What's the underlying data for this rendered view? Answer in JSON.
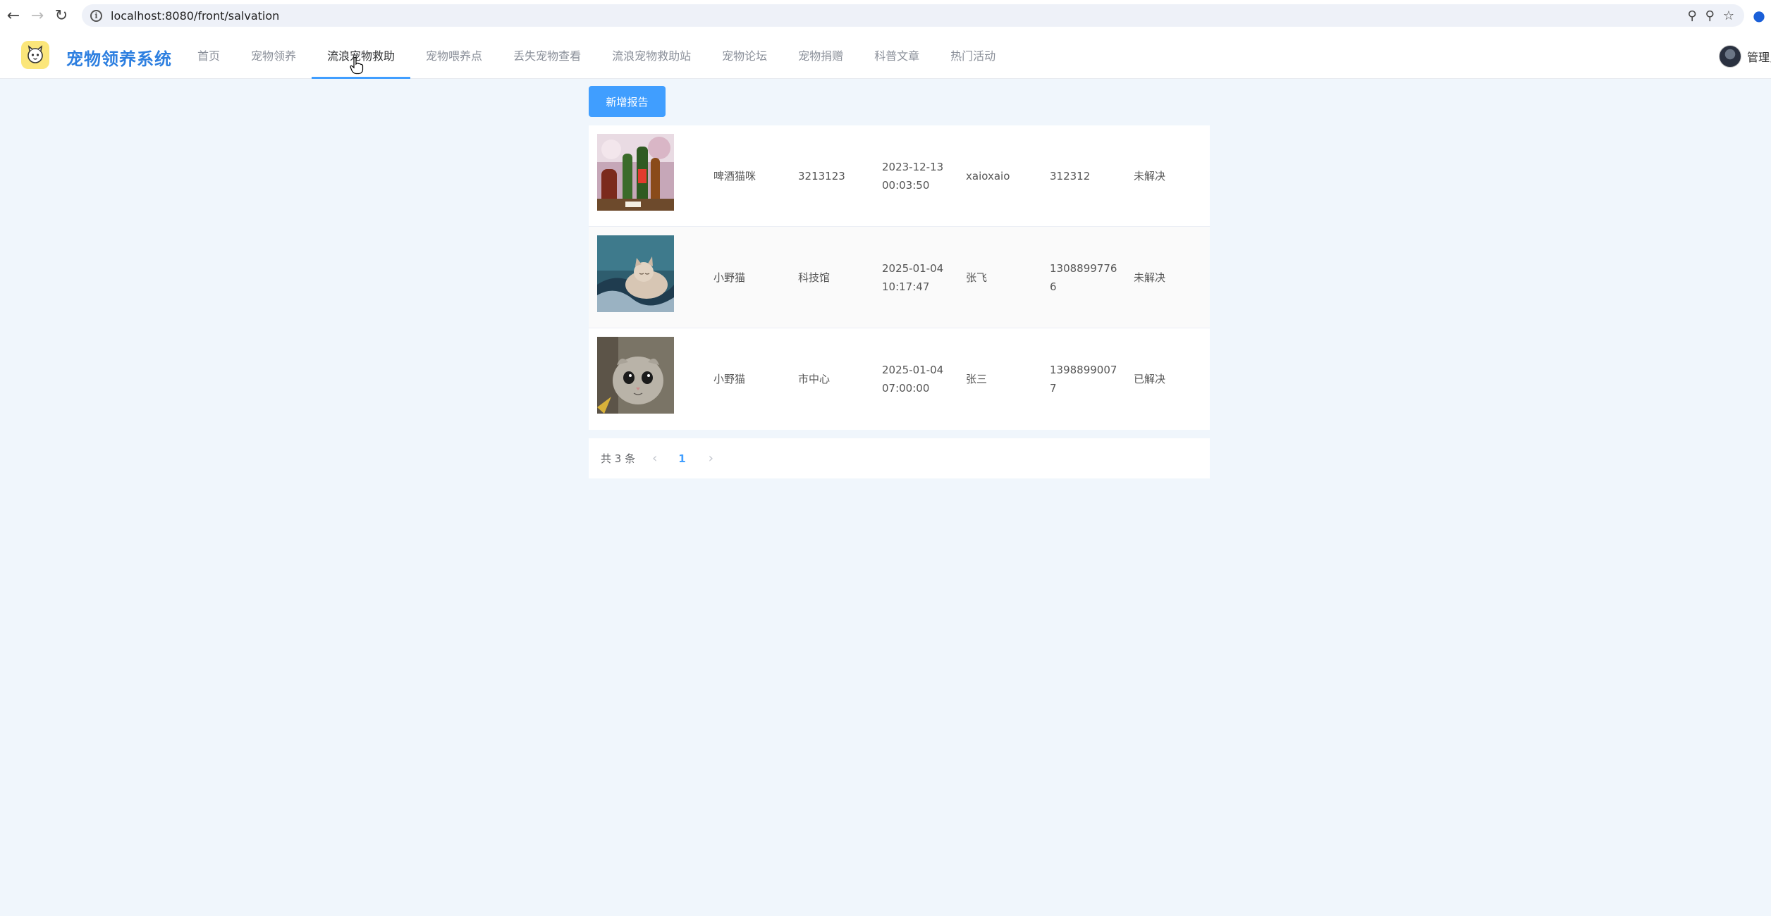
{
  "browser": {
    "url": "localhost:8080/front/salvation",
    "back_icon": "arrow-left-icon",
    "forward_icon": "arrow-right-icon",
    "reload_icon": "reload-icon"
  },
  "header": {
    "brand": "宠物领养系统",
    "nav": [
      {
        "label": "首页"
      },
      {
        "label": "宠物领养"
      },
      {
        "label": "流浪宠物救助"
      },
      {
        "label": "宠物喂养点"
      },
      {
        "label": "丢失宠物查看"
      },
      {
        "label": "流浪宠物救助站"
      },
      {
        "label": "宠物论坛"
      },
      {
        "label": "宠物捐赠"
      },
      {
        "label": "科普文章"
      },
      {
        "label": "热门活动"
      }
    ],
    "active_nav": "流浪宠物救助",
    "user_name": "管理员"
  },
  "actions": {
    "add_report": "新增报告"
  },
  "reports": [
    {
      "image": "beer-cat-photo",
      "name": "啤酒猫咪",
      "place": "3213123",
      "time": "2023-12-13 00:03:50",
      "person": "xaioxaio",
      "phone": "312312",
      "status": "未解决"
    },
    {
      "image": "sleeping-cat-photo",
      "name": "小野猫",
      "place": "科技馆",
      "time": "2025-01-04 10:17:47",
      "person": "张飞",
      "phone": "13088997766",
      "status": "未解决"
    },
    {
      "image": "grey-cat-photo",
      "name": "小野猫",
      "place": "市中心",
      "time": "2025-01-04 07:00:00",
      "person": "张三",
      "phone": "13988990077",
      "status": "已解决"
    }
  ],
  "pagination": {
    "total": "共 3 条",
    "current_page": "1"
  },
  "colors": {
    "accent": "#409eff",
    "brand": "#2d7fe0",
    "page_bg": "#f0f6fc"
  }
}
